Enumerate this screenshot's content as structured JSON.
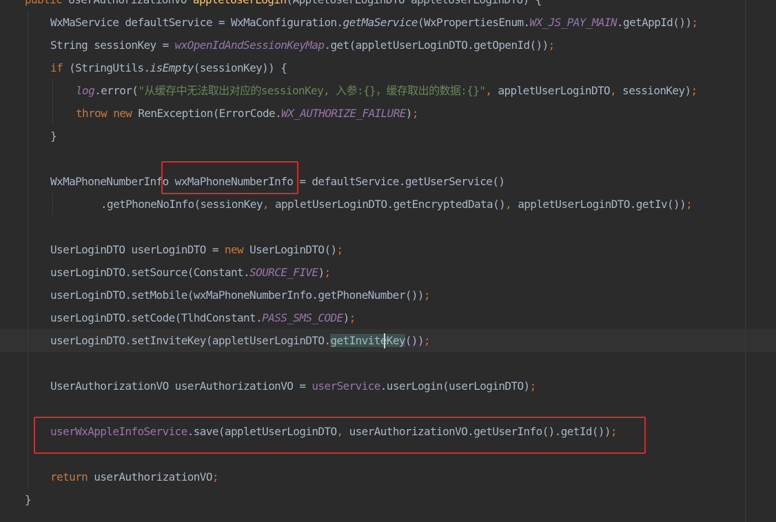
{
  "editor": {
    "lines": [
      {
        "id": "l0",
        "segs": [
          {
            "t": "public ",
            "c": "kw"
          },
          {
            "t": "UserAuthorizationVO "
          },
          {
            "t": "appletUserLogin",
            "c": "fn"
          },
          {
            "t": "(AppletUserLoginDTO appletUserLoginDTO) {"
          }
        ]
      },
      {
        "id": "l1",
        "segs": [
          {
            "t": "WxMaService defaultService = WxMaConfiguration."
          },
          {
            "t": "getMaService",
            "c": "sfn"
          },
          {
            "t": "(WxPropertiesEnum."
          },
          {
            "t": "WX_JS_PAY_MAIN",
            "c": "fld"
          },
          {
            "t": ".getAppId())"
          },
          {
            "t": ";",
            "c": "kw"
          }
        ]
      },
      {
        "id": "l2",
        "segs": [
          {
            "t": "String sessionKey = "
          },
          {
            "t": "wxOpenIdAndSessionKeyMap",
            "c": "fld"
          },
          {
            "t": ".get(appletUserLoginDTO.getOpenId())"
          },
          {
            "t": ";",
            "c": "kw"
          }
        ]
      },
      {
        "id": "l3",
        "segs": [
          {
            "t": "if ",
            "c": "kw"
          },
          {
            "t": "(StringUtils."
          },
          {
            "t": "isEmpty",
            "c": "sfn"
          },
          {
            "t": "(sessionKey)) {"
          }
        ]
      },
      {
        "id": "l4",
        "segs": [
          {
            "t": "log",
            "c": "fld"
          },
          {
            "t": ".error("
          },
          {
            "t": "\"从缓存中无法取出对应的sessionKey, 入参:{}，缓存取出的数据:{}\"",
            "c": "str"
          },
          {
            "t": ", ",
            "c": "kw"
          },
          {
            "t": "appletUserLoginDTO"
          },
          {
            "t": ", ",
            "c": "kw"
          },
          {
            "t": "sessionKey)"
          },
          {
            "t": ";",
            "c": "kw"
          }
        ]
      },
      {
        "id": "l5",
        "segs": [
          {
            "t": "throw new ",
            "c": "kw"
          },
          {
            "t": "RenException(ErrorCode."
          },
          {
            "t": "WX_AUTHORIZE_FAILURE",
            "c": "fld"
          },
          {
            "t": ")"
          },
          {
            "t": ";",
            "c": "kw"
          }
        ]
      },
      {
        "id": "l6",
        "segs": [
          {
            "t": "}"
          }
        ]
      },
      {
        "id": "l7",
        "segs": []
      },
      {
        "id": "l8",
        "segs": [
          {
            "t": "WxMaPhoneNumberInfo wxMaPhoneNumberInfo = defaultService.getUserService()"
          }
        ]
      },
      {
        "id": "l9",
        "segs": [
          {
            "t": ".getPhoneNoInfo(sessionKey"
          },
          {
            "t": ", ",
            "c": "kw"
          },
          {
            "t": "appletUserLoginDTO.getEncryptedData()"
          },
          {
            "t": ", ",
            "c": "kw"
          },
          {
            "t": "appletUserLoginDTO.getIv())"
          },
          {
            "t": ";",
            "c": "kw"
          }
        ]
      },
      {
        "id": "l10",
        "segs": []
      },
      {
        "id": "l11",
        "segs": [
          {
            "t": "UserLoginDTO userLoginDTO = "
          },
          {
            "t": "new ",
            "c": "kw"
          },
          {
            "t": "UserLoginDTO()"
          },
          {
            "t": ";",
            "c": "kw"
          }
        ]
      },
      {
        "id": "l12",
        "segs": [
          {
            "t": "userLoginDTO.setSource(Constant."
          },
          {
            "t": "SOURCE_FIVE",
            "c": "fld"
          },
          {
            "t": ")"
          },
          {
            "t": ";",
            "c": "kw"
          }
        ]
      },
      {
        "id": "l13",
        "segs": [
          {
            "t": "userLoginDTO.setMobile(wxMaPhoneNumberInfo.getPhoneNumber())"
          },
          {
            "t": ";",
            "c": "kw"
          }
        ]
      },
      {
        "id": "l14",
        "segs": [
          {
            "t": "userLoginDTO.setCode(TlhdConstant."
          },
          {
            "t": "PASS_SMS_CODE",
            "c": "fld"
          },
          {
            "t": ")"
          },
          {
            "t": ";",
            "c": "kw"
          }
        ]
      },
      {
        "id": "l15",
        "segs": [
          {
            "t": "userLoginDTO.setInviteKey(appletUserLoginDTO."
          },
          {
            "t": "getInviteKey",
            "c": "hl-ident"
          },
          {
            "t": "())"
          },
          {
            "t": ";",
            "c": "kw"
          }
        ]
      },
      {
        "id": "l16",
        "segs": []
      },
      {
        "id": "l17",
        "segs": [
          {
            "t": "UserAuthorizationVO userAuthorizationVO = "
          },
          {
            "t": "userService",
            "c": "ifld"
          },
          {
            "t": ".userLogin(userLoginDTO)"
          },
          {
            "t": ";",
            "c": "kw"
          }
        ]
      },
      {
        "id": "l18",
        "segs": []
      },
      {
        "id": "l19",
        "segs": [
          {
            "t": "userWxAppleInfoService",
            "c": "ifld"
          },
          {
            "t": ".save(appletUserLoginDTO"
          },
          {
            "t": ", ",
            "c": "kw"
          },
          {
            "t": "userAuthorizationVO.getUserInfo().getId())"
          },
          {
            "t": ";",
            "c": "kw"
          }
        ]
      },
      {
        "id": "l20",
        "segs": []
      },
      {
        "id": "l21",
        "segs": [
          {
            "t": "return ",
            "c": "kw"
          },
          {
            "t": "userAuthorizationVO"
          },
          {
            "t": ";",
            "c": "kw"
          }
        ]
      },
      {
        "id": "l22",
        "segs": [
          {
            "t": "}"
          }
        ]
      }
    ]
  },
  "colors": {
    "background": "#2b2b2b",
    "current_line": "#323232",
    "keyword": "#cc7832",
    "field": "#9876aa",
    "string": "#6a8759",
    "method_decl": "#ffc66d",
    "default_text": "#a9b7c6",
    "annotation_box": "#e8261c"
  }
}
